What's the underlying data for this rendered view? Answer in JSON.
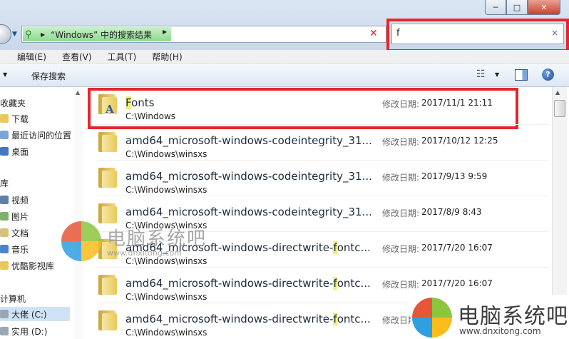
{
  "window": {
    "controls": [
      "─",
      "□",
      "✕"
    ]
  },
  "address": {
    "crumb": "“Windows” 中的搜索结果",
    "search_icon": "search-icon"
  },
  "search": {
    "value": "f",
    "clear": "×"
  },
  "menu": {
    "items": [
      "编辑(E)",
      "查看(V)",
      "工具(T)",
      "帮助(H)"
    ]
  },
  "toolbar": {
    "save_search": "保存搜索"
  },
  "nav": {
    "items": [
      {
        "label": "收藏夹",
        "icon": "star-icon"
      },
      {
        "label": "下载",
        "icon": "download-folder-icon"
      },
      {
        "label": "最近访问的位置",
        "icon": "recent-places-icon"
      },
      {
        "label": "桌面",
        "icon": "desktop-icon"
      },
      {
        "label": "库",
        "icon": "library-icon"
      },
      {
        "label": "视频",
        "icon": "video-library-icon"
      },
      {
        "label": "图片",
        "icon": "picture-library-icon"
      },
      {
        "label": "文档",
        "icon": "document-library-icon"
      },
      {
        "label": "音乐",
        "icon": "music-library-icon"
      },
      {
        "label": "优酷影视库",
        "icon": "folder-icon"
      },
      {
        "label": "计算机",
        "icon": "computer-icon"
      },
      {
        "label": "大佬 (C:)",
        "icon": "drive-icon"
      },
      {
        "label": "实用 (D:)",
        "icon": "drive-icon"
      }
    ]
  },
  "results": {
    "date_label": "修改日期:",
    "items": [
      {
        "name_hl": "F",
        "name_rest": "onts",
        "path": "C:\\Windows",
        "date": "2017/11/1 21:11"
      },
      {
        "name_pre": "amd64_microsoft-windows-codeintegrity_31...",
        "path": "C:\\Windows\\winsxs",
        "date": "2017/10/12 12:25"
      },
      {
        "name_pre": "amd64_microsoft-windows-codeintegrity_31...",
        "path": "C:\\Windows\\winsxs",
        "date": "2017/9/13 9:59"
      },
      {
        "name_pre": "amd64_microsoft-windows-codeintegrity_31...",
        "path": "C:\\Windows\\winsxs",
        "date": "2017/8/9 8:43"
      },
      {
        "name_pre": "amd64_microsoft-windows-directwrite-",
        "name_hl": "f",
        "name_post": "ontc...",
        "path": "C:\\Windows\\winsxs",
        "date": "2017/7/20 16:07"
      },
      {
        "name_pre": "amd64_microsoft-windows-directwrite-",
        "name_hl": "f",
        "name_post": "ontc...",
        "path": "C:\\Windows\\winsxs",
        "date": "2017/7/20 16:07"
      },
      {
        "name_pre": "amd64_microsoft-windows-directwrite-",
        "name_hl": "f",
        "name_post": "ontc...",
        "path": "C:\\Windows\\winsxs",
        "date": ""
      }
    ]
  },
  "watermark": {
    "brand": "电脑系统吧",
    "url": "www.dnxitong.com"
  }
}
